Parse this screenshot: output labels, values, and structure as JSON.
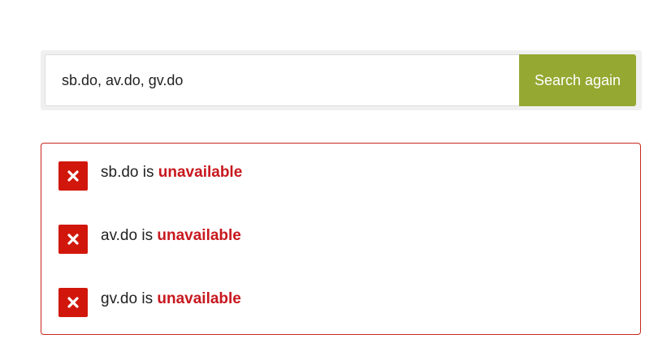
{
  "search": {
    "value": "sb.do, av.do, gv.do",
    "button_label": "Search again"
  },
  "results": [
    {
      "domain": "sb.do",
      "connector": "is",
      "status": "unavailable",
      "icon": "x-icon"
    },
    {
      "domain": "av.do",
      "connector": "is",
      "status": "unavailable",
      "icon": "x-icon"
    },
    {
      "domain": "gv.do",
      "connector": "is",
      "status": "unavailable",
      "icon": "x-icon"
    }
  ],
  "colors": {
    "accent": "#95a831",
    "unavailable": "#d1170c",
    "border": "#c8281e"
  }
}
